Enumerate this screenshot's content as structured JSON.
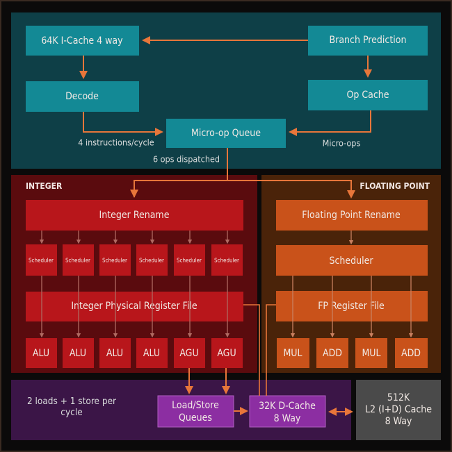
{
  "colors": {
    "frontend_bg": "#0e3f47",
    "frontend_box": "#138995",
    "integer_bg": "#5a0b0e",
    "integer_box": "#b8161b",
    "fp_bg": "#4a2309",
    "fp_box": "#c9521a",
    "memory_bg": "#3b1547",
    "memory_box": "#8c2ea2",
    "l2_bg": "#4a4a4a",
    "arrow": "#e8763a"
  },
  "frontend": {
    "icache": "64K I-Cache 4 way",
    "branch": "Branch Prediction",
    "decode": "Decode",
    "opcache": "Op Cache",
    "uopq": "Micro-op Queue",
    "label_decode": "4 instructions/cycle",
    "label_microops": "Micro-ops",
    "label_dispatch": "6 ops dispatched"
  },
  "integer": {
    "title": "INTEGER",
    "rename": "Integer Rename",
    "schedulers": [
      "Scheduler",
      "Scheduler",
      "Scheduler",
      "Scheduler",
      "Scheduler",
      "Scheduler"
    ],
    "prf": "Integer Physical Register File",
    "units": [
      "ALU",
      "ALU",
      "ALU",
      "ALU",
      "AGU",
      "AGU"
    ]
  },
  "fp": {
    "title": "FLOATING POINT",
    "rename": "Floating Point Rename",
    "scheduler": "Scheduler",
    "rf": "FP Register File",
    "units": [
      "MUL",
      "ADD",
      "MUL",
      "ADD"
    ]
  },
  "memory": {
    "note_line1": "2 loads + 1 store  per",
    "note_line2": "cycle",
    "lsq_line1": "Load/Store",
    "lsq_line2": "Queues",
    "dcache_line1": "32K D-Cache",
    "dcache_line2": "8 Way"
  },
  "l2": {
    "line1": "512K",
    "line2": "L2 (I+D) Cache",
    "line3": "8 Way"
  }
}
